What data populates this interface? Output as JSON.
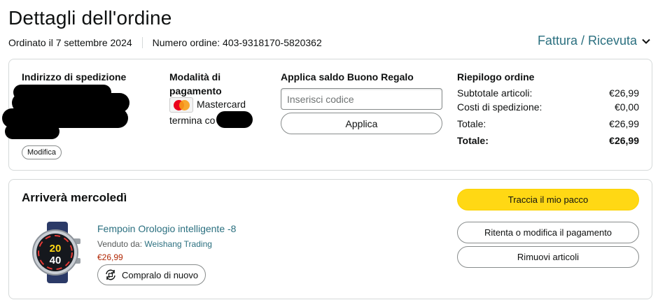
{
  "header": {
    "title": "Dettagli dell'ordine",
    "ordered_on": "Ordinato il 7 settembre 2024",
    "order_number": "Numero ordine: 403-9318170-5820362",
    "invoice_label": "Fattura / Ricevuta"
  },
  "shipping": {
    "heading": "Indirizzo di spedizione",
    "edit_label": "Modifica"
  },
  "payment": {
    "heading_line1": "Modalità di",
    "heading_line2": "pagamento",
    "card_brand": "Mastercard",
    "ending_text": "termina co"
  },
  "gift": {
    "heading": "Applica saldo Buono Regalo",
    "placeholder": "Inserisci codice",
    "apply_label": "Applica"
  },
  "summary": {
    "heading": "Riepilogo ordine",
    "rows": [
      {
        "label": "Subtotale articoli:",
        "value": "€26,99"
      },
      {
        "label": "Costi di spedizione:",
        "value": "€0,00"
      },
      {
        "label": "Totale:",
        "value": "€26,99"
      }
    ],
    "grand_total_label": "Totale:",
    "grand_total_value": "€26,99"
  },
  "delivery": {
    "heading": "Arriverà mercoledì",
    "product_title": "Fempoin Orologio intelligente -8",
    "sold_by_label": "Venduto da:",
    "seller_name": "Weishang Trading",
    "price": "€26,99",
    "rebuy_label": "Compralo di nuovo",
    "watch_display": [
      "20",
      "40"
    ]
  },
  "actions": {
    "track": "Traccia il mio pacco",
    "retry_payment": "Ritenta o modifica il pagamento",
    "remove_items": "Rimuovi articoli"
  },
  "colors": {
    "link": "#2a6f7f",
    "price": "#b12704",
    "primary_button": "#ffd814",
    "border": "#d5d9d9"
  }
}
